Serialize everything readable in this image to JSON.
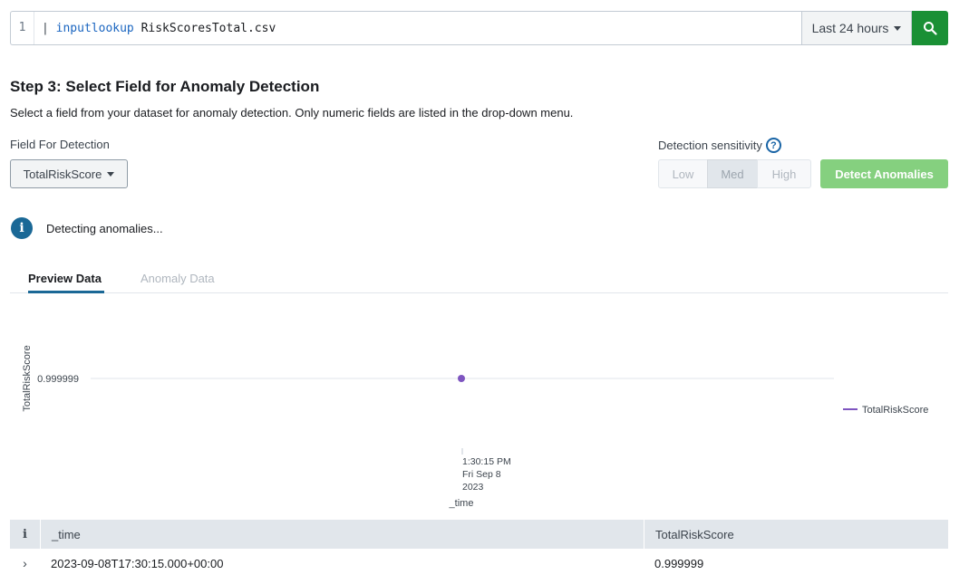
{
  "search": {
    "line_number": "1",
    "pipe": "|",
    "command": "inputlookup",
    "argument": "RiskScoresTotal.csv",
    "time_range": "Last 24 hours",
    "search_icon": "search-icon"
  },
  "step": {
    "title": "Step 3: Select Field for Anomaly Detection",
    "description": "Select a field from your dataset for anomaly detection. Only numeric fields are listed in the drop-down menu."
  },
  "field": {
    "label": "Field For Detection",
    "selected": "TotalRiskScore"
  },
  "sensitivity": {
    "label": "Detection sensitivity",
    "help": "?",
    "options": [
      "Low",
      "Med",
      "High"
    ],
    "selected": "Med"
  },
  "detect_button": "Detect Anomalies",
  "status": {
    "icon": "i",
    "message": "Detecting anomalies..."
  },
  "tabs": [
    {
      "label": "Preview Data",
      "active": true
    },
    {
      "label": "Anomaly Data",
      "active": false
    }
  ],
  "chart_data": {
    "type": "line",
    "ylabel": "TotalRiskScore",
    "xlabel": "_time",
    "y_ticks": [
      "0.999999"
    ],
    "x_ticks": [
      [
        "1:30:15 PM",
        "Fri Sep 8",
        "2023"
      ]
    ],
    "series": [
      {
        "name": "TotalRiskScore",
        "color": "#7e55c0",
        "points": [
          {
            "x": "1:30:15 PM Fri Sep 8 2023",
            "y": 0.999999
          }
        ]
      }
    ],
    "legend": "right"
  },
  "table": {
    "info_col": "i",
    "columns": [
      "_time",
      "TotalRiskScore"
    ],
    "rows": [
      {
        "expander": "›",
        "time": "2023-09-08T17:30:15.000+00:00",
        "score": "0.999999"
      }
    ]
  },
  "colors": {
    "accent_green": "#1a9035",
    "detect_disabled": "#85d07f",
    "info_blue": "#1a6896",
    "series_purple": "#7e55c0"
  }
}
